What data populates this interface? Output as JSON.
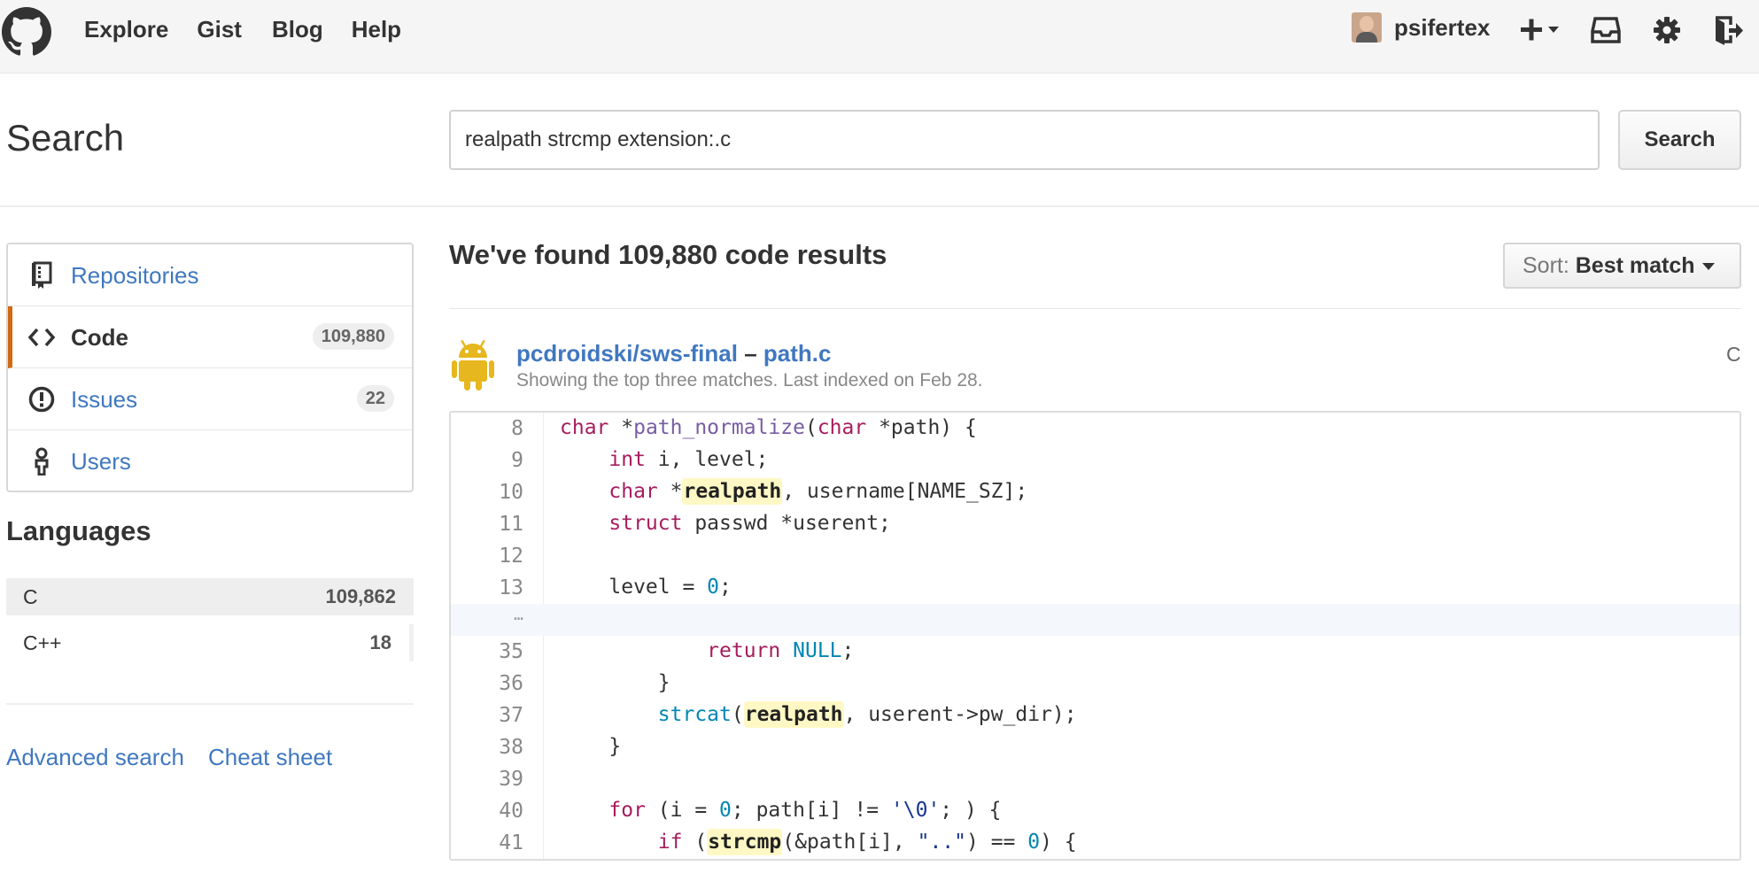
{
  "header": {
    "nav": [
      "Explore",
      "Gist",
      "Blog",
      "Help"
    ],
    "username": "psifertex"
  },
  "search": {
    "title": "Search",
    "query": "realpath strcmp extension:.c",
    "button": "Search"
  },
  "sidebar": {
    "menu": [
      {
        "label": "Repositories",
        "icon": "repo-icon",
        "count": ""
      },
      {
        "label": "Code",
        "icon": "code-icon",
        "count": "109,880"
      },
      {
        "label": "Issues",
        "icon": "issue-icon",
        "count": "22"
      },
      {
        "label": "Users",
        "icon": "person-icon",
        "count": ""
      }
    ],
    "languages_title": "Languages",
    "languages": [
      {
        "name": "C",
        "count": "109,862"
      },
      {
        "name": "C++",
        "count": "18"
      }
    ],
    "advanced_search": "Advanced search",
    "cheat_sheet": "Cheat sheet"
  },
  "results": {
    "title": "We've found 109,880 code results",
    "sort_label": "Sort:",
    "sort_value": "Best match",
    "item": {
      "repo": "pcdroidski/sws-final",
      "separator": "–",
      "file": "path.c",
      "meta": "Showing the top three matches. Last indexed on Feb 28.",
      "language": "C"
    },
    "lines": [
      {
        "num": "8"
      },
      {
        "num": "9"
      },
      {
        "num": "10"
      },
      {
        "num": "11"
      },
      {
        "num": "12"
      },
      {
        "num": "13"
      },
      {
        "num": "…"
      },
      {
        "num": "35"
      },
      {
        "num": "36"
      },
      {
        "num": "37"
      },
      {
        "num": "38"
      },
      {
        "num": "39"
      },
      {
        "num": "40"
      },
      {
        "num": "41"
      }
    ]
  },
  "colors": {
    "link": "#4078c0",
    "selected_accent": "#d26911",
    "android": "#e6b71e",
    "highlight": "#fff8c4"
  }
}
